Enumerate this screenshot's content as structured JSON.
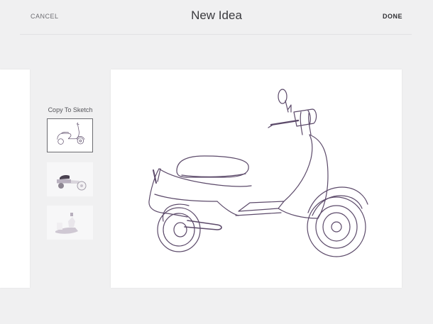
{
  "header": {
    "cancel_label": "CANCEL",
    "title": "New Idea",
    "done_label": "DONE"
  },
  "sidebar": {
    "copy_label": "Copy To Sketch",
    "thumbnails": [
      {
        "name": "scooter-sketch",
        "selected": true
      },
      {
        "name": "scooter-colored",
        "selected": false
      },
      {
        "name": "shape-sketch",
        "selected": false
      }
    ]
  },
  "colors": {
    "background": "#f0f0f1",
    "card": "#ffffff",
    "sketch_stroke": "#5c4a6a"
  }
}
